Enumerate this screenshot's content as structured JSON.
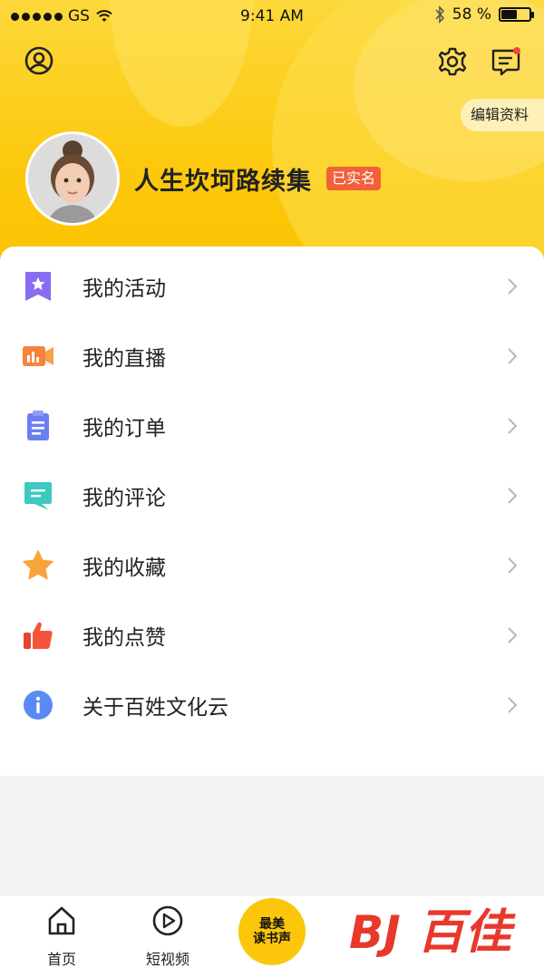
{
  "status_bar": {
    "carrier": "GS",
    "time": "9:41 AM",
    "battery_percent": "58 %",
    "battery_level": 0.58
  },
  "header": {
    "profile_icon": "user-circle-icon",
    "settings_icon": "gear-icon",
    "messages_icon": "message-icon",
    "edit_profile_label": "编辑资料",
    "username": "人生坎坷路续集",
    "verified_badge": "已实名",
    "accent_color": "#fcc90e"
  },
  "menu": {
    "items": [
      {
        "label": "我的活动",
        "icon": "activity-bookmark-icon",
        "color": "#8a6cf0"
      },
      {
        "label": "我的直播",
        "icon": "live-camera-icon",
        "color": "#f7823c"
      },
      {
        "label": "我的订单",
        "icon": "order-clipboard-icon",
        "color": "#6c7ff0"
      },
      {
        "label": "我的评论",
        "icon": "comment-bubble-icon",
        "color": "#3cc9c0"
      },
      {
        "label": "我的收藏",
        "icon": "star-icon",
        "color": "#f7a43a"
      },
      {
        "label": "我的点赞",
        "icon": "thumbs-up-icon",
        "color": "#f4553a"
      },
      {
        "label": "关于百姓文化云",
        "icon": "info-icon",
        "color": "#5b8af5"
      }
    ]
  },
  "tabbar": {
    "tabs": [
      {
        "label": "首页",
        "icon": "home-icon"
      },
      {
        "label": "短视频",
        "icon": "play-icon"
      }
    ],
    "center_button": {
      "line1": "最美",
      "line2": "读书声"
    },
    "watermark_text": "百佳"
  }
}
